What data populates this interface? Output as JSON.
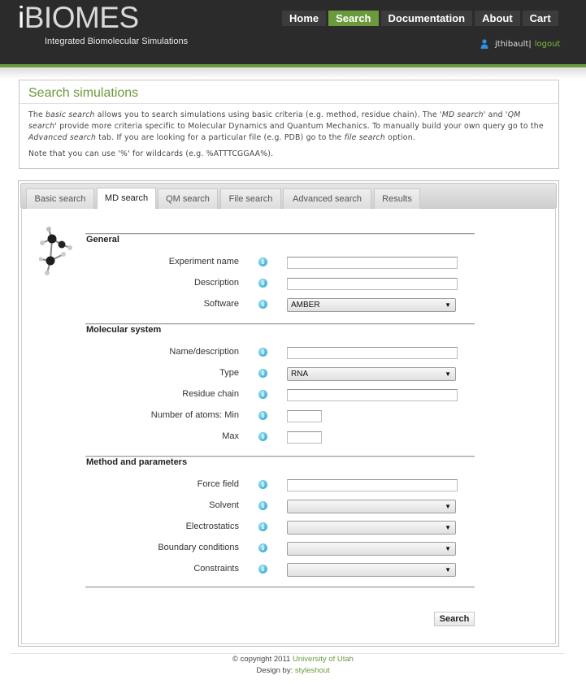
{
  "header": {
    "logo_i": "i",
    "logo_rest": "BIOMES",
    "tagline": "Integrated Biomolecular Simulations",
    "nav": [
      "Home",
      "Search",
      "Documentation",
      "About",
      "Cart"
    ],
    "active_nav": "Search",
    "username": "jthibault",
    "separator": "|",
    "logout": "logout"
  },
  "intro": {
    "title": "Search simulations",
    "p1_a": "The ",
    "p1_basic": "basic search",
    "p1_b": " allows you to search simulations using basic criteria (e.g. method, residue chain). The '",
    "p1_md": "MD search",
    "p1_c": "' and '",
    "p1_qm": "QM search",
    "p1_d": "' provide more criteria specific to Molecular Dynamics and Quantum Mechanics. To manually build your own query go to the ",
    "p1_adv": "Advanced search",
    "p1_e": " tab. If you are looking for a particular file (e.g. PDB) go to the ",
    "p1_file": "file search",
    "p1_f": " option.",
    "note": "Note that you can use '%' for wildcards (e.g. %ATTTCGGAA%)."
  },
  "tabs": [
    "Basic search",
    "MD search",
    "QM search",
    "File search",
    "Advanced search",
    "Results"
  ],
  "active_tab": "MD search",
  "form": {
    "general": {
      "title": "General",
      "experiment_name": {
        "label": "Experiment name",
        "value": ""
      },
      "description": {
        "label": "Description",
        "value": ""
      },
      "software": {
        "label": "Software",
        "value": "AMBER"
      }
    },
    "molecular": {
      "title": "Molecular system",
      "name_description": {
        "label": "Name/description",
        "value": ""
      },
      "type": {
        "label": "Type",
        "value": "RNA"
      },
      "residue_chain": {
        "label": "Residue chain",
        "value": ""
      },
      "atoms_min": {
        "label": "Number of atoms: Min",
        "value": ""
      },
      "atoms_max": {
        "label": "Max",
        "value": ""
      }
    },
    "method": {
      "title": "Method and parameters",
      "force_field": {
        "label": "Force field",
        "value": ""
      },
      "solvent": {
        "label": "Solvent",
        "value": ""
      },
      "electrostatics": {
        "label": "Electrostatics",
        "value": ""
      },
      "boundary": {
        "label": "Boundary conditions",
        "value": ""
      },
      "constraints": {
        "label": "Constraints",
        "value": ""
      }
    },
    "info_glyph": "i",
    "dropdown_glyph": "▼",
    "search_button": "Search"
  },
  "footer": {
    "copyright": "© copyright 2011",
    "university": "University of Utah",
    "design_by": "Design by:",
    "designer": "styleshout"
  },
  "colors": {
    "accent": "#6a9a3c",
    "header_bg": "#2b2b2b",
    "info_icon": "#1d9ec8"
  }
}
